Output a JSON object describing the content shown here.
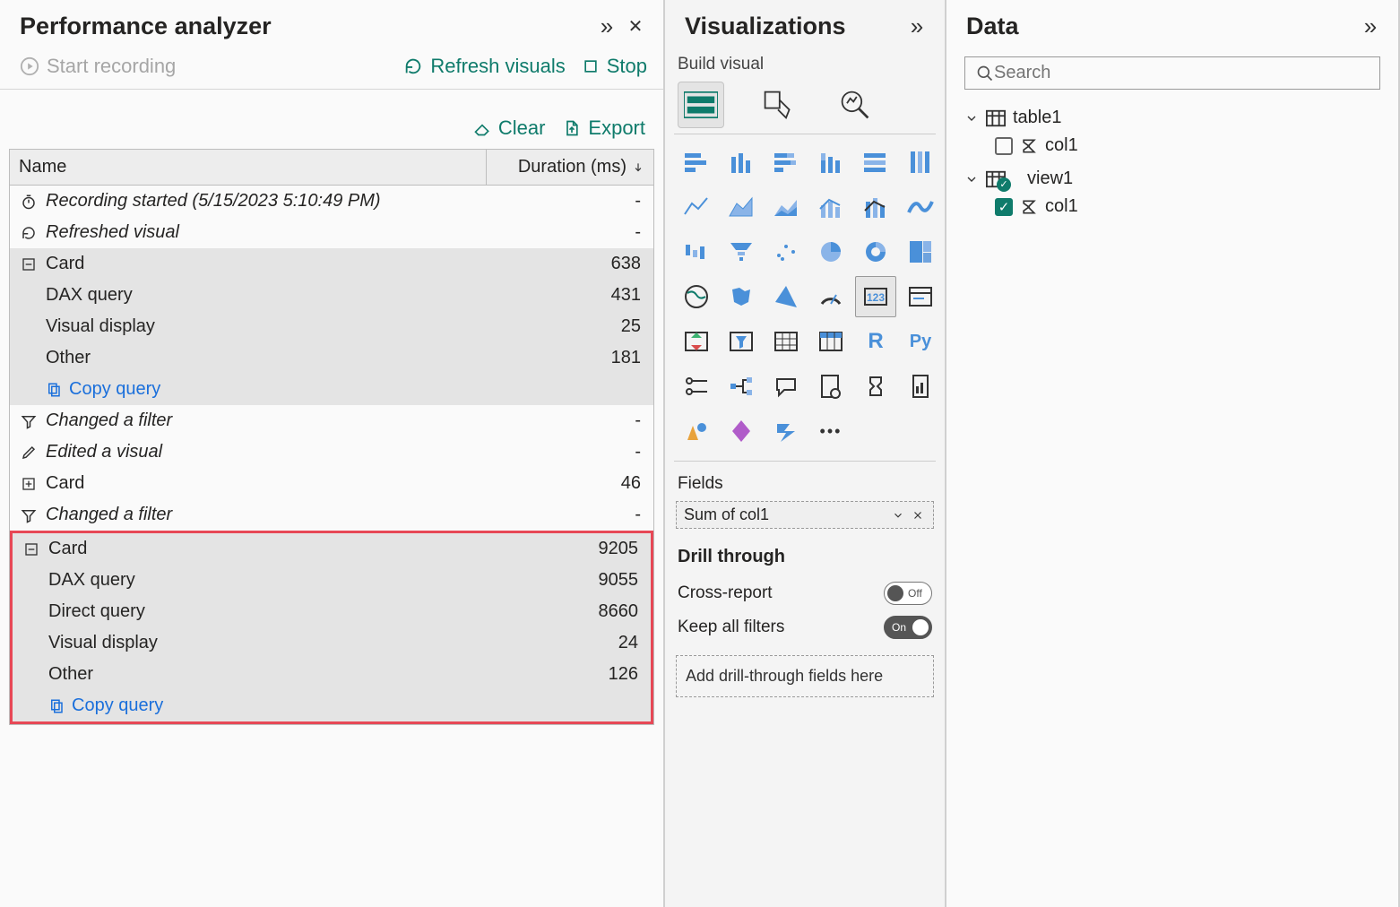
{
  "perf": {
    "title": "Performance analyzer",
    "start_recording": "Start recording",
    "refresh_visuals": "Refresh visuals",
    "stop": "Stop",
    "clear": "Clear",
    "export": "Export",
    "col_name": "Name",
    "col_duration": "Duration (ms)",
    "rows": {
      "recording_started": "Recording started (5/15/2023 5:10:49 PM)",
      "refreshed_visual": "Refreshed visual",
      "card1": {
        "label": "Card",
        "dur": "638",
        "dax": "DAX query",
        "dax_dur": "431",
        "vis": "Visual display",
        "vis_dur": "25",
        "other": "Other",
        "other_dur": "181",
        "copy": "Copy query"
      },
      "changed_filter1": "Changed a filter",
      "edited_visual": "Edited a visual",
      "card2": {
        "label": "Card",
        "dur": "46"
      },
      "changed_filter2": "Changed a filter",
      "card3": {
        "label": "Card",
        "dur": "9205",
        "dax": "DAX query",
        "dax_dur": "9055",
        "direct": "Direct query",
        "direct_dur": "8660",
        "vis": "Visual display",
        "vis_dur": "24",
        "other": "Other",
        "other_dur": "126",
        "copy": "Copy query"
      }
    }
  },
  "viz": {
    "title": "Visualizations",
    "build_visual": "Build visual",
    "fields": "Fields",
    "field_value": "Sum of col1",
    "drill_through": "Drill through",
    "cross_report": "Cross-report",
    "cross_report_toggle": "Off",
    "keep_filters": "Keep all filters",
    "keep_filters_toggle": "On",
    "dropzone": "Add drill-through fields here",
    "ellipsis": "•••",
    "r_label": "R",
    "py_label": "Py"
  },
  "data": {
    "title": "Data",
    "search_placeholder": "Search",
    "table1": "table1",
    "table1_col": "col1",
    "view1": "view1",
    "view1_col": "col1"
  }
}
